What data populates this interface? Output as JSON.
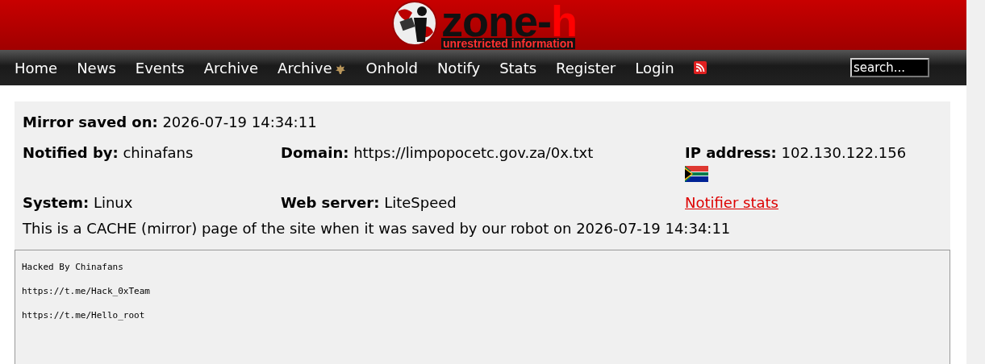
{
  "logo": {
    "wordmark": "zone-",
    "wordmark_accent": "h",
    "tagline": "unrestricted information"
  },
  "nav": {
    "items": [
      {
        "label": "Home",
        "badge": false
      },
      {
        "label": "News",
        "badge": false
      },
      {
        "label": "Events",
        "badge": false
      },
      {
        "label": "Archive",
        "badge": false
      },
      {
        "label": "Archive",
        "badge": true
      },
      {
        "label": "Onhold",
        "badge": false
      },
      {
        "label": "Notify",
        "badge": false
      },
      {
        "label": "Stats",
        "badge": false
      },
      {
        "label": "Register",
        "badge": false
      },
      {
        "label": "Login",
        "badge": false
      }
    ],
    "search": {
      "value": "search..."
    }
  },
  "details": {
    "saved": {
      "label": "Mirror saved on:",
      "value": "2026-07-19 14:34:11"
    },
    "rows": [
      [
        {
          "kind": "field",
          "label": "Notified by:",
          "value": "chinafans"
        },
        {
          "kind": "field",
          "label": "Domain:",
          "value": "https://limpopocetc.gov.za/0x.txt"
        },
        {
          "kind": "field",
          "label": "IP address:",
          "value": "102.130.122.156",
          "flag": true
        }
      ],
      [
        {
          "kind": "field",
          "label": "System:",
          "value": "Linux"
        },
        {
          "kind": "field",
          "label": "Web server:",
          "value": "LiteSpeed"
        },
        {
          "kind": "link",
          "label": "Notifier stats"
        }
      ]
    ],
    "note": "This is a CACHE (mirror) page of the site when it was saved by our robot on 2026-07-19 14:34:11"
  },
  "mirror": {
    "lines": [
      "Hacked By Chinafans",
      "https://t.me/Hack_0xTeam",
      "https://t.me/Hello_root"
    ]
  }
}
